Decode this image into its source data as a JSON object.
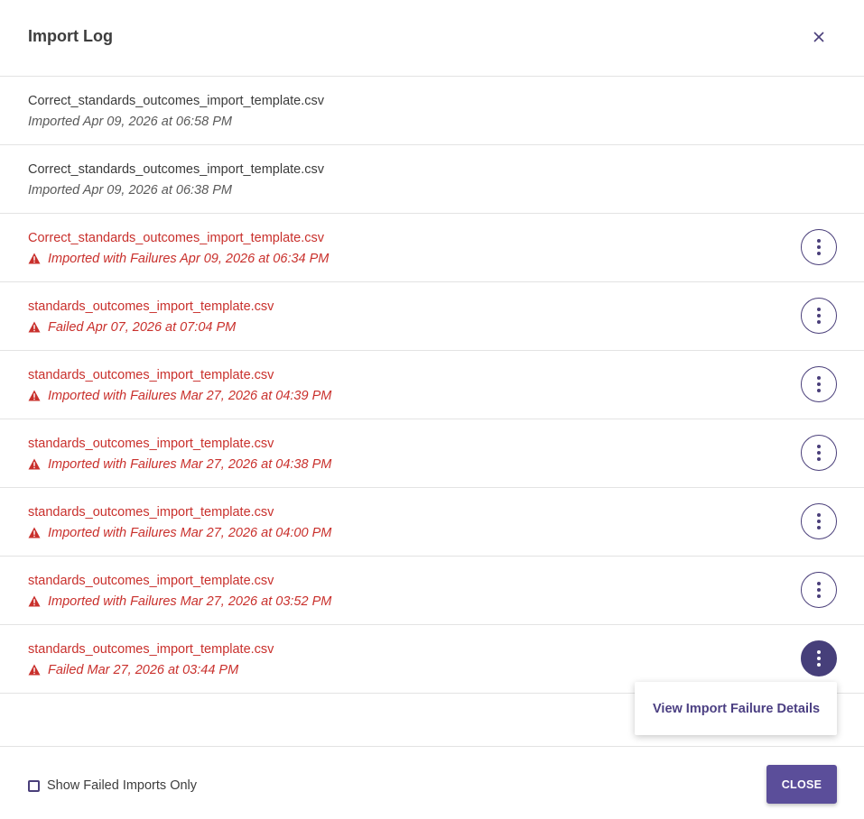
{
  "modal": {
    "title": "Import Log",
    "close_icon": "close-icon"
  },
  "imports": [
    {
      "filename": "Correct_standards_outcomes_import_template.csv",
      "status": "Imported Apr 09, 2026 at 06:58 PM",
      "failed": false
    },
    {
      "filename": "Correct_standards_outcomes_import_template.csv",
      "status": "Imported Apr 09, 2026 at 06:38 PM",
      "failed": false
    },
    {
      "filename": "Correct_standards_outcomes_import_template.csv",
      "status": "Imported with Failures Apr 09, 2026 at 06:34 PM",
      "failed": true
    },
    {
      "filename": "standards_outcomes_import_template.csv",
      "status": "Failed Apr 07, 2026 at 07:04 PM",
      "failed": true
    },
    {
      "filename": "standards_outcomes_import_template.csv",
      "status": "Imported with Failures Mar 27, 2026 at 04:39 PM",
      "failed": true
    },
    {
      "filename": "standards_outcomes_import_template.csv",
      "status": "Imported with Failures Mar 27, 2026 at 04:38 PM",
      "failed": true
    },
    {
      "filename": "standards_outcomes_import_template.csv",
      "status": "Imported with Failures Mar 27, 2026 at 04:00 PM",
      "failed": true
    },
    {
      "filename": "standards_outcomes_import_template.csv",
      "status": "Imported with Failures Mar 27, 2026 at 03:52 PM",
      "failed": true
    },
    {
      "filename": "standards_outcomes_import_template.csv",
      "status": "Failed Mar 27, 2026 at 03:44 PM",
      "failed": true
    }
  ],
  "menu": {
    "item_label": "View Import Failure Details"
  },
  "footer": {
    "checkbox_label": "Show Failed Imports Only",
    "checkbox_checked": false,
    "close_label": "CLOSE"
  },
  "colors": {
    "accent": "#4a3f7a",
    "button": "#5b4e9a",
    "error": "#c9302c"
  },
  "icons": {
    "warning": "warning-triangle-icon",
    "more": "more-vertical-icon"
  }
}
